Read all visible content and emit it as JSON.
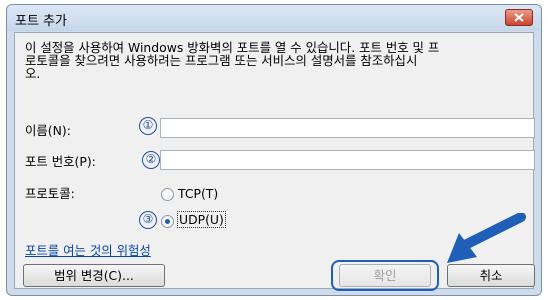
{
  "dialog": {
    "title": "포트 추가",
    "close_glyph": "✕",
    "description": "이 설정을 사용하여 Windows 방화벽의 포트를 열 수 있습니다. 포트 번호 및 프\n로토콜을 찾으려면 사용하려는 프로그램 또는 서비스의 설명서를 참조하십시\n오."
  },
  "form": {
    "name_label": "이름(N):",
    "name_value": "",
    "port_label": "포트 번호(P):",
    "port_value": "",
    "protocol_label": "프로토콜:",
    "tcp_label": "TCP(T)",
    "udp_label": "UDP(U)",
    "selected_protocol": "UDP"
  },
  "callouts": [
    "①",
    "②",
    "③"
  ],
  "link": {
    "text": "포트를 여는 것의 위험성"
  },
  "buttons": {
    "scope": "범위 변경(C)...",
    "ok": "확인",
    "cancel": "취소"
  },
  "colors": {
    "accent": "#1f5fb8",
    "arrow": "#1f5fb8",
    "close": "#c9452e"
  }
}
